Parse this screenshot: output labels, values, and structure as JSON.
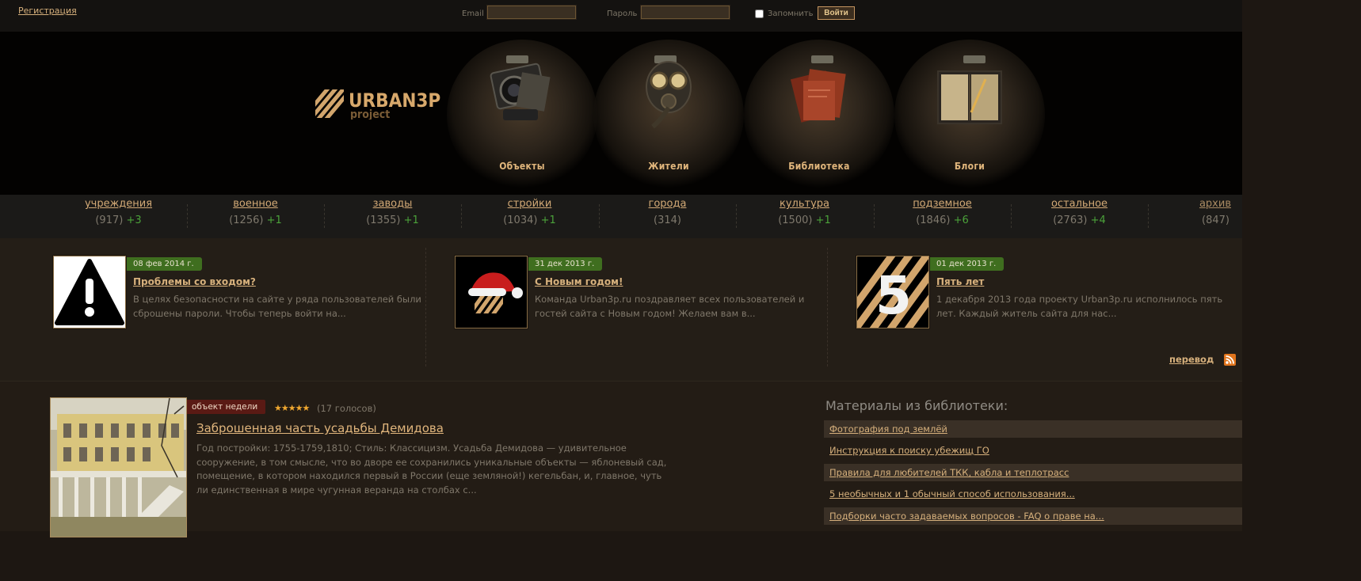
{
  "topbar": {
    "register_link": "Регистрация",
    "email_label": "Email",
    "email_value": "",
    "password_label": "Пароль",
    "password_value": "",
    "remember_label": "Запомнить",
    "login_button": "Войти"
  },
  "header": {
    "logo_text": "URBAN3P",
    "logo_subtext": "project",
    "nav": [
      {
        "label": "Объекты",
        "icon": "camera-icon"
      },
      {
        "label": "Жители",
        "icon": "gas-mask-icon"
      },
      {
        "label": "Библиотека",
        "icon": "books-icon"
      },
      {
        "label": "Блоги",
        "icon": "notebook-icon"
      }
    ]
  },
  "categories": [
    {
      "name": "учреждения",
      "count": "(917)",
      "delta": "+3"
    },
    {
      "name": "военное",
      "count": "(1256)",
      "delta": "+1"
    },
    {
      "name": "заводы",
      "count": "(1355)",
      "delta": "+1"
    },
    {
      "name": "стройки",
      "count": "(1034)",
      "delta": "+1"
    },
    {
      "name": "города",
      "count": "(314)",
      "delta": ""
    },
    {
      "name": "культура",
      "count": "(1500)",
      "delta": "+1"
    },
    {
      "name": "подземное",
      "count": "(1846)",
      "delta": "+6"
    },
    {
      "name": "остальное",
      "count": "(2763)",
      "delta": "+4"
    },
    {
      "name": "архив",
      "count": "(847)",
      "delta": ""
    }
  ],
  "news": [
    {
      "date": "08 фев 2014 г.",
      "title": "Проблемы со входом?",
      "text": "В целях безопасности на сайте у ряда пользователей были сброшены пароли. Чтобы теперь войти на...",
      "thumb": "warning-icon"
    },
    {
      "date": "31 дек 2013 г.",
      "title": "С Новым годом!",
      "text": "Команда Urban3p.ru поздравляет всех пользователей и гостей сайта с Новым годом! Желаем вам в...",
      "thumb": "santa-hat-logo"
    },
    {
      "date": "01 дек 2013 г.",
      "title": "Пять лет",
      "text": "1 декабря 2013 года проекту Urban3p.ru исполнилось пять лет. Каждый житель сайта для нас...",
      "thumb": "five-years-logo",
      "thumb_text": "5"
    }
  ],
  "translate_link": "перевод",
  "object_of_week": {
    "badge": "объект недели",
    "stars": "★★★★★",
    "votes": "(17 голосов)",
    "title": "Заброшенная часть усадьбы Демидова",
    "description": "Год постройки: 1755-1759,1810; Стиль: Классицизм. Усадьба Демидова — удивительное сооружение, в том смысле, что во дворе ее сохранились уникальные объекты — яблоневый сад, помещение, в котором находился первый в России (еще земляной!) кегельбан, и, главное, чуть ли единственная в мире чугунная веранда на столбах с..."
  },
  "library": {
    "heading": "Материалы из библиотеки:",
    "items": [
      "Фотография под землёй",
      "Инструкция к поиску убежищ ГО",
      "Правила для любителей ТКК, кабла и теплотрасс",
      "5 необычных и 1 обычный способ использования...",
      "Подборки часто задаваемых вопросов - FAQ о праве на..."
    ]
  },
  "colors": {
    "accent_link": "#d6b07c",
    "delta_green": "#4ba23a",
    "date_badge": "#3f6e1f",
    "week_badge": "#5a1a14"
  }
}
